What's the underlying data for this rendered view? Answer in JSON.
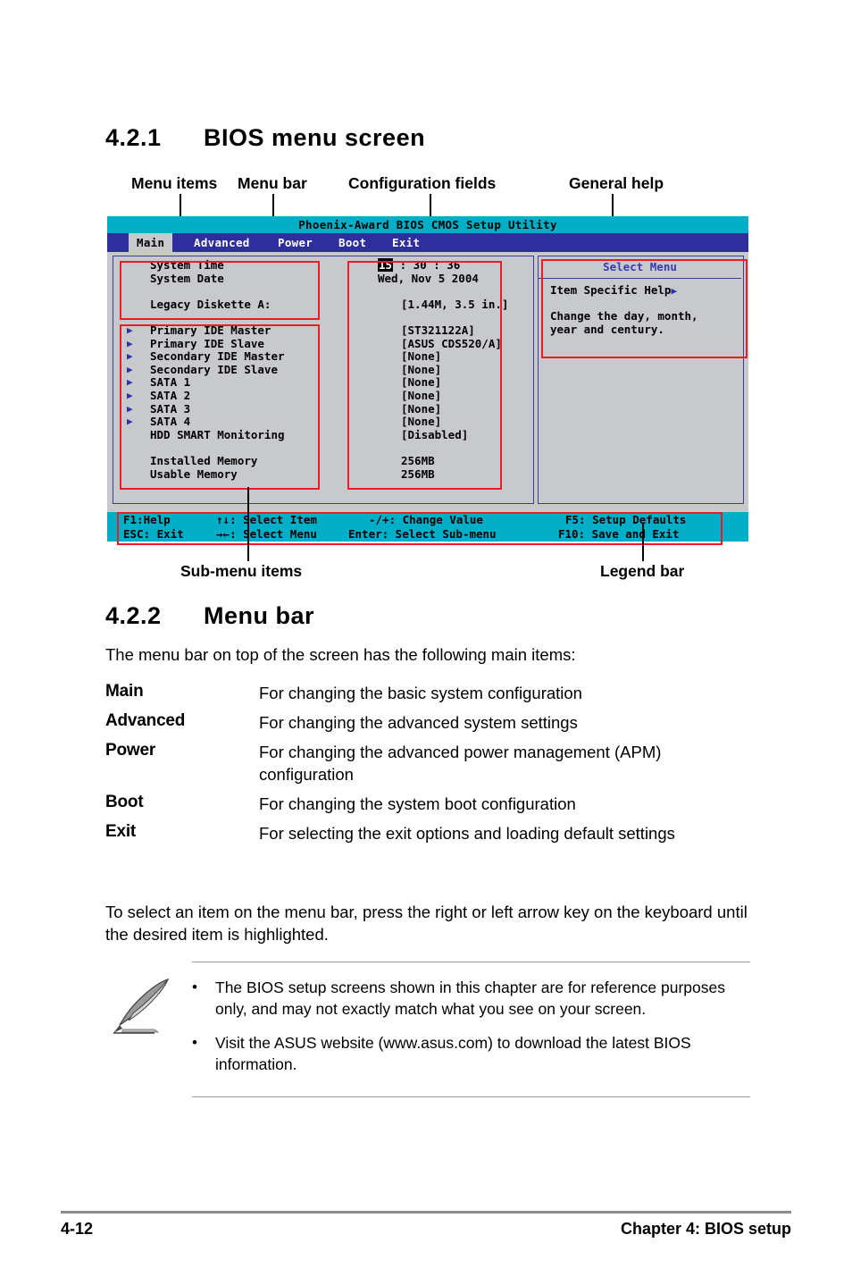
{
  "sections": {
    "s1_number": "4.2.1",
    "s1_title": "BIOS menu screen",
    "s2_number": "4.2.2",
    "s2_title": "Menu bar"
  },
  "callouts": {
    "menu_items": "Menu items",
    "menu_bar": "Menu bar",
    "configuration_fields": "Configuration fields",
    "general_help": "General help",
    "sub_menu_items": "Sub-menu items",
    "legend_bar": "Legend bar"
  },
  "bios": {
    "title": "Phoenix-Award BIOS CMOS Setup Utility",
    "menu_tabs": [
      {
        "label": "Main",
        "selected": true
      },
      {
        "label": "Advanced",
        "selected": false
      },
      {
        "label": "Power",
        "selected": false
      },
      {
        "label": "Boot",
        "selected": false
      },
      {
        "label": "Exit",
        "selected": false
      }
    ],
    "items": [
      {
        "arrow": false,
        "label": "System Time",
        "value": "15 : 30 : 36",
        "highlight": "15"
      },
      {
        "arrow": false,
        "label": "System Date",
        "value": "Wed, Nov 5 2004"
      },
      {
        "arrow": false,
        "label": "",
        "value": ""
      },
      {
        "arrow": false,
        "label": "Legacy Diskette A:",
        "value": "[1.44M, 3.5 in.]"
      },
      {
        "arrow": false,
        "label": "",
        "value": ""
      },
      {
        "arrow": true,
        "label": "Primary IDE Master",
        "value": "[ST321122A]"
      },
      {
        "arrow": true,
        "label": "Primary IDE Slave",
        "value": "[ASUS CDS520/A]"
      },
      {
        "arrow": true,
        "label": "Secondary IDE Master",
        "value": "[None]"
      },
      {
        "arrow": true,
        "label": "Secondary IDE Slave",
        "value": "[None]"
      },
      {
        "arrow": true,
        "label": "SATA 1",
        "value": "[None]"
      },
      {
        "arrow": true,
        "label": "SATA 2",
        "value": "[None]"
      },
      {
        "arrow": true,
        "label": "SATA 3",
        "value": "[None]"
      },
      {
        "arrow": true,
        "label": "SATA 4",
        "value": "[None]"
      },
      {
        "arrow": false,
        "label": "HDD SMART Monitoring",
        "value": "[Disabled]"
      },
      {
        "arrow": false,
        "label": "",
        "value": ""
      },
      {
        "arrow": false,
        "label": "Installed Memory",
        "value": "256MB"
      },
      {
        "arrow": false,
        "label": "Usable Memory",
        "value": "256MB"
      }
    ],
    "help": {
      "title": "Select Menu",
      "subtitle": "Item Specific Help",
      "lines": [
        "Change the day, month,",
        "year and century."
      ]
    },
    "legend": {
      "row1": [
        {
          "key": "F1:Help",
          "desc": ""
        },
        {
          "key": "↑↓",
          "desc": ": Select Item"
        },
        {
          "key": "-/+:",
          "desc": " Change Value"
        },
        {
          "key": "F5:",
          "desc": " Setup Defaults"
        }
      ],
      "row2": [
        {
          "key": "ESC: Exit",
          "desc": ""
        },
        {
          "key": "→←",
          "desc": ": Select Menu"
        },
        {
          "key": "Enter:",
          "desc": " Select Sub-menu"
        },
        {
          "key": "F10:",
          "desc": " Save and Exit"
        }
      ]
    }
  },
  "menubar_section": {
    "intro": "The menu bar on top of the screen has the following main items:",
    "entries": [
      {
        "term": "Main",
        "desc": "For changing the basic system configuration"
      },
      {
        "term": "Advanced",
        "desc": "For changing the advanced system settings"
      },
      {
        "term": "Power",
        "desc": "For changing the advanced power management (APM) configuration"
      },
      {
        "term": "Boot",
        "desc": "For changing the system boot configuration"
      },
      {
        "term": "Exit",
        "desc": "For selecting the exit options and loading default settings"
      }
    ],
    "closing": "To select an item on the menu bar, press the right or left arrow key on the keyboard until the desired item is highlighted."
  },
  "note": {
    "bullet_glyph": "•",
    "items": [
      "The BIOS setup screens shown in this chapter are for reference purposes only, and may not exactly match what you see on your screen.",
      "Visit the ASUS website (www.asus.com) to download the latest BIOS information."
    ]
  },
  "footer": {
    "page": "4-12",
    "chapter": "Chapter 4: BIOS setup"
  },
  "colors": {
    "bios_title_bar": "#00aec7",
    "bios_menu_bar": "#2e2e9e",
    "bios_body": "#c7c9cc",
    "annotation_red": "#ee1c24",
    "help_title_blue": "#3b3bb0"
  }
}
